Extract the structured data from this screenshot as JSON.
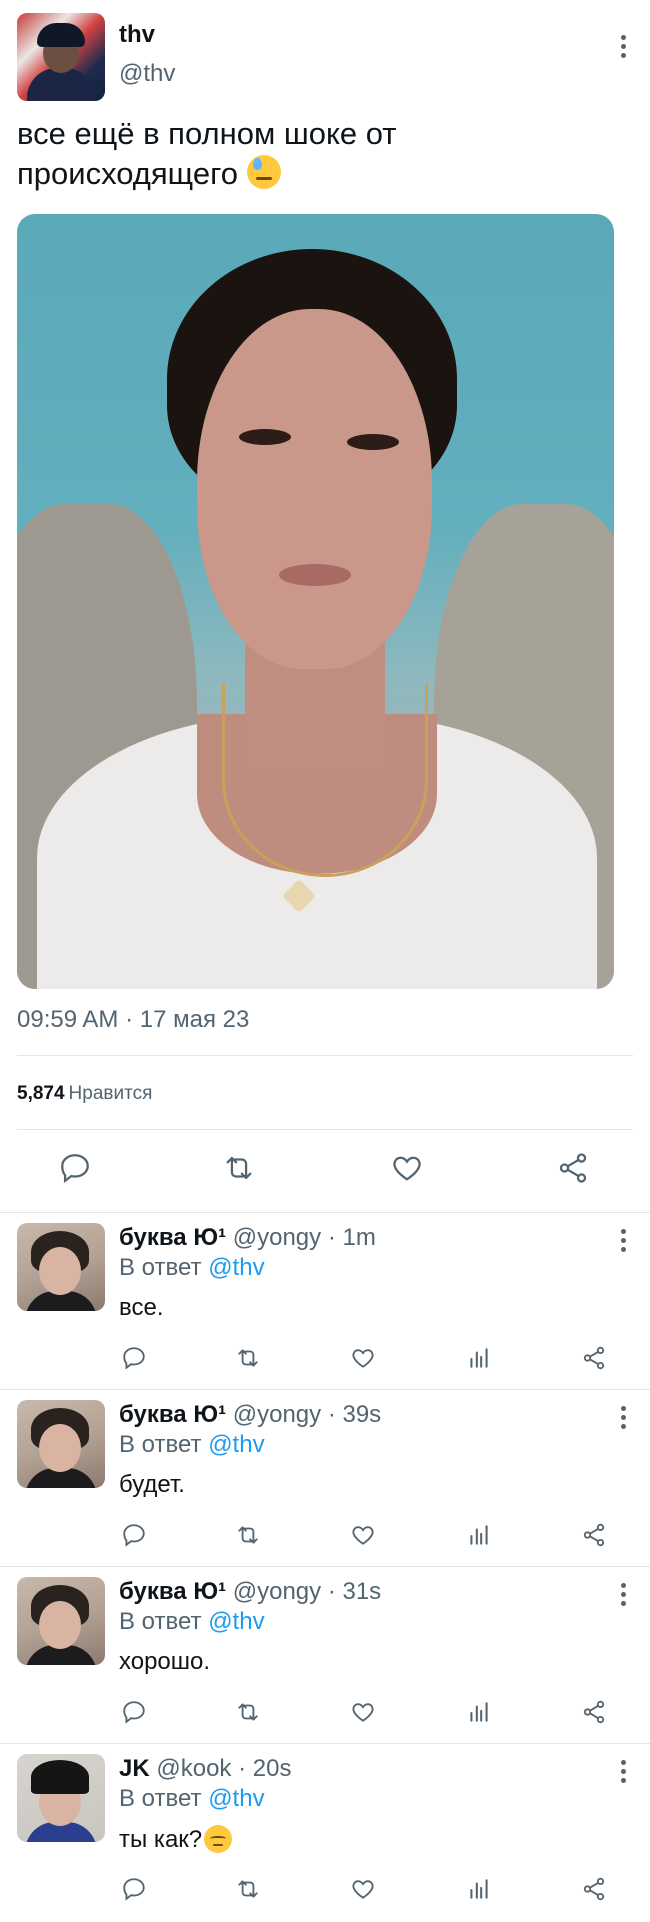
{
  "tweet": {
    "author_name": "thv",
    "author_handle": "@thv",
    "text": "все ещё в полном шоке от происходящего",
    "emoji": "sweat-emoji",
    "timestamp": "09:59 AM · 17 мая 23",
    "likes_count": "5,874",
    "likes_label": "Нравится"
  },
  "replies": [
    {
      "name": "буква Ю¹",
      "handle": "@yongy",
      "time": "· 1m",
      "replying_prefix": "В ответ",
      "mention": "@thv",
      "text": "все."
    },
    {
      "name": "буква Ю¹",
      "handle": "@yongy",
      "time": "· 39s",
      "replying_prefix": "В ответ",
      "mention": "@thv",
      "text": "будет."
    },
    {
      "name": "буква Ю¹",
      "handle": "@yongy",
      "time": "· 31s",
      "replying_prefix": "В ответ",
      "mention": "@thv",
      "text": "хорошо."
    },
    {
      "name": "JK",
      "handle": "@kook",
      "time": "· 20s",
      "replying_prefix": "В ответ",
      "mention": "@thv",
      "text": "ты как?",
      "emoji": "pensive-emoji"
    }
  ],
  "icons": [
    "more-icon",
    "reply-icon",
    "retweet-icon",
    "like-icon",
    "share-icon",
    "views-icon"
  ],
  "colors": {
    "text": "#0f1419",
    "secondary": "#536471",
    "link": "#1d9bf0",
    "divider": "#e1e6ea"
  }
}
